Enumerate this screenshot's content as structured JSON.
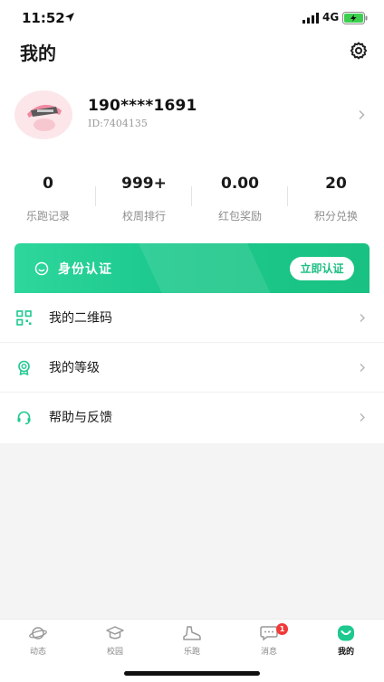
{
  "status_bar": {
    "time": "11:52",
    "network": "4G"
  },
  "header": {
    "title": "我的"
  },
  "profile": {
    "username": "190****1691",
    "user_id": "ID:7404135"
  },
  "stats": [
    {
      "value": "0",
      "label": "乐跑记录"
    },
    {
      "value": "999+",
      "label": "校周排行"
    },
    {
      "value": "0.00",
      "label": "红包奖励"
    },
    {
      "value": "20",
      "label": "积分兑换"
    }
  ],
  "auth_banner": {
    "label": "身份认证",
    "button": "立即认证"
  },
  "menu": [
    {
      "label": "我的二维码",
      "icon": "qr-code-icon"
    },
    {
      "label": "我的等级",
      "icon": "level-badge-icon"
    },
    {
      "label": "帮助与反馈",
      "icon": "headset-icon"
    }
  ],
  "tabbar": {
    "items": [
      {
        "label": "动态",
        "icon": "planet-icon"
      },
      {
        "label": "校园",
        "icon": "graduation-cap-icon"
      },
      {
        "label": "乐跑",
        "icon": "shoe-icon"
      },
      {
        "label": "消息",
        "icon": "chat-bubble-icon",
        "badge": "1"
      },
      {
        "label": "我的",
        "icon": "smile-face-icon"
      }
    ],
    "active_index": 4
  },
  "colors": {
    "accent": "#1dc98e",
    "badge": "#f03a3a"
  }
}
